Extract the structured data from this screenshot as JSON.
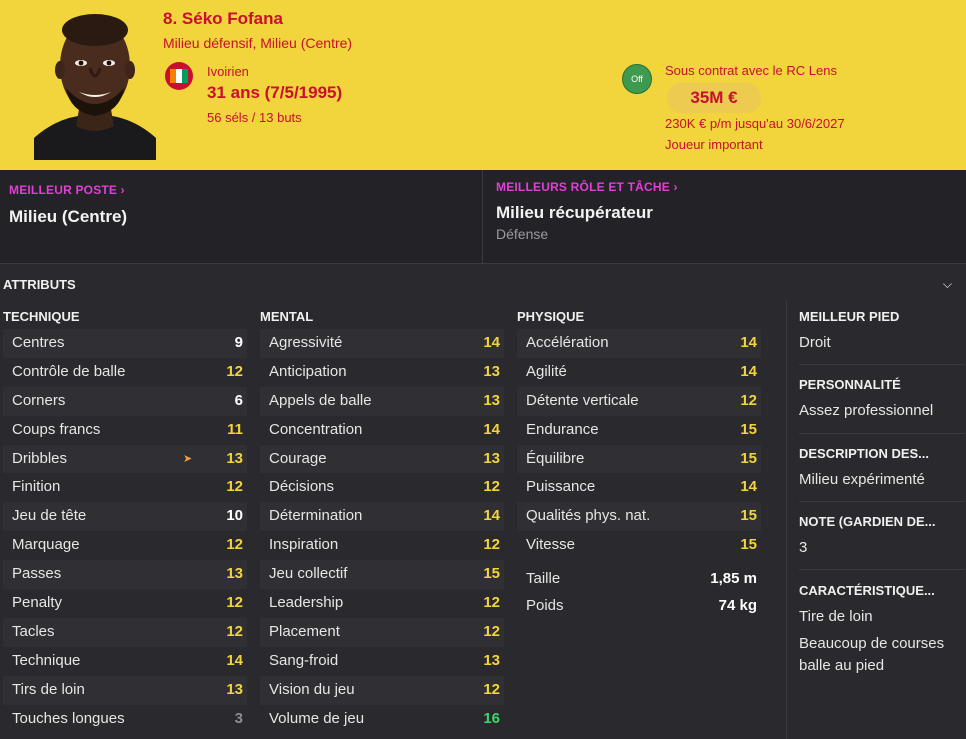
{
  "player": {
    "name": "8. Séko Fofana",
    "positions": "Milieu défensif, Milieu (Centre)",
    "nationality": "Ivoirien",
    "age": "31 ans (7/5/1995)",
    "caps": "56 séls / 13 buts",
    "flag_colors": [
      "#f77f00",
      "#ffffff",
      "#009e60"
    ]
  },
  "contract": {
    "badge": "Off",
    "club": "Sous contrat avec le RC Lens",
    "value": "35M €",
    "salary": "230K € p/m jusqu'au 30/6/2027",
    "status": "Joueur important"
  },
  "best_position": {
    "title": "MEILLEUR POSTE",
    "value": "Milieu (Centre)"
  },
  "best_role": {
    "title": "MEILLEURS RÔLE ET TÂCHE",
    "value": "Milieu récupérateur",
    "sub": "Défense"
  },
  "attributes": {
    "title": "ATTRIBUTS",
    "technical": {
      "title": "TECHNIQUE",
      "rows": [
        {
          "label": "Centres",
          "value": "9"
        },
        {
          "label": "Contrôle de balle",
          "value": "12"
        },
        {
          "label": "Corners",
          "value": "6"
        },
        {
          "label": "Coups francs",
          "value": "11"
        },
        {
          "label": "Dribbles",
          "value": "13"
        },
        {
          "label": "Finition",
          "value": "12"
        },
        {
          "label": "Jeu de tête",
          "value": "10"
        },
        {
          "label": "Marquage",
          "value": "12"
        },
        {
          "label": "Passes",
          "value": "13"
        },
        {
          "label": "Penalty",
          "value": "12"
        },
        {
          "label": "Tacles",
          "value": "12"
        },
        {
          "label": "Technique",
          "value": "14"
        },
        {
          "label": "Tirs de loin",
          "value": "13"
        },
        {
          "label": "Touches longues",
          "value": "3"
        }
      ]
    },
    "mental": {
      "title": "MENTAL",
      "rows": [
        {
          "label": "Agressivité",
          "value": "14"
        },
        {
          "label": "Anticipation",
          "value": "13"
        },
        {
          "label": "Appels de balle",
          "value": "13"
        },
        {
          "label": "Concentration",
          "value": "14"
        },
        {
          "label": "Courage",
          "value": "13"
        },
        {
          "label": "Décisions",
          "value": "12"
        },
        {
          "label": "Détermination",
          "value": "14"
        },
        {
          "label": "Inspiration",
          "value": "12"
        },
        {
          "label": "Jeu collectif",
          "value": "15"
        },
        {
          "label": "Leadership",
          "value": "12"
        },
        {
          "label": "Placement",
          "value": "12"
        },
        {
          "label": "Sang-froid",
          "value": "13"
        },
        {
          "label": "Vision du jeu",
          "value": "12"
        },
        {
          "label": "Volume de jeu",
          "value": "16"
        }
      ]
    },
    "physical": {
      "title": "PHYSIQUE",
      "rows": [
        {
          "label": "Accélération",
          "value": "14"
        },
        {
          "label": "Agilité",
          "value": "14"
        },
        {
          "label": "Détente verticale",
          "value": "12"
        },
        {
          "label": "Endurance",
          "value": "15"
        },
        {
          "label": "Équilibre",
          "value": "15"
        },
        {
          "label": "Puissance",
          "value": "14"
        },
        {
          "label": "Qualités phys. nat.",
          "value": "15"
        },
        {
          "label": "Vitesse",
          "value": "15"
        }
      ],
      "height_label": "Taille",
      "height": "1,85 m",
      "weight_label": "Poids",
      "weight": "74 kg"
    }
  },
  "sidebar": {
    "foot_title": "MEILLEUR PIED",
    "foot": "Droit",
    "personality_title": "PERSONNALITÉ",
    "personality": "Assez professionnel",
    "desc_title": "DESCRIPTION DES...",
    "desc": "Milieu expérimenté",
    "gk_title": "NOTE (GARDIEN DE...",
    "gk": "3",
    "traits_title": "CARACTÉRISTIQUE...",
    "trait_1": "Tire de loin",
    "trait_2": "Beaucoup de courses balle au pied"
  }
}
